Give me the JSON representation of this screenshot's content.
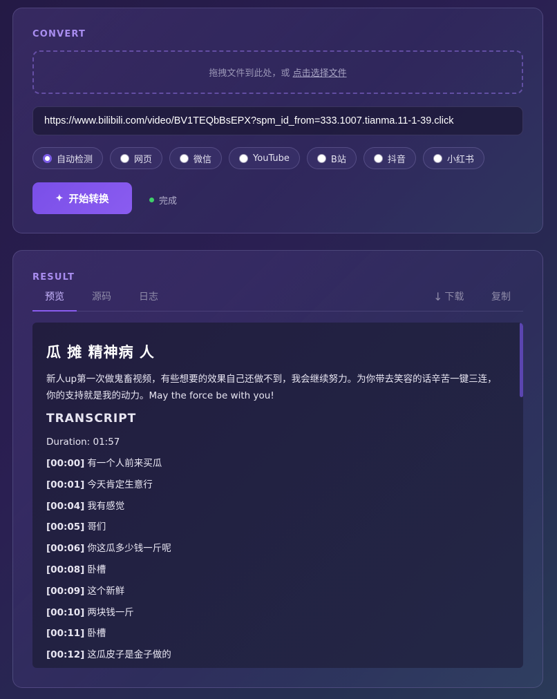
{
  "convert": {
    "section_label": "CONVERT",
    "dropzone_text": "拖拽文件到此处，或",
    "dropzone_link": "点击选择文件",
    "url_value": "https://www.bilibili.com/video/BV1TEQbBsEPX?spm_id_from=333.1007.tianma.11-1-39.click",
    "sources": [
      {
        "label": "自动检测",
        "selected": true
      },
      {
        "label": "网页",
        "selected": false
      },
      {
        "label": "微信",
        "selected": false
      },
      {
        "label": "YouTube",
        "selected": false
      },
      {
        "label": "B站",
        "selected": false
      },
      {
        "label": "抖音",
        "selected": false
      },
      {
        "label": "小红书",
        "selected": false
      }
    ],
    "start_button": "开始转换",
    "start_icon": "✦",
    "status_text": "完成",
    "status_color": "#3fcf6a"
  },
  "result": {
    "section_label": "RESULT",
    "tabs": [
      {
        "label": "预览",
        "active": true
      },
      {
        "label": "源码",
        "active": false
      },
      {
        "label": "日志",
        "active": false
      }
    ],
    "download_label": "下载",
    "download_icon": "↓",
    "copy_label": "复制",
    "doc": {
      "title": "瓜 摊 精神病 人",
      "description": "新人up第一次做鬼畜视频，有些想要的效果自己还做不到，我会继续努力。为你带去笑容的话辛苦一键三连，你的支持就是我的动力。May the force be with you!",
      "heading": "TRANSCRIPT",
      "duration": "Duration: 01:57",
      "lines": [
        {
          "ts": "[00:00]",
          "text": "有一个人前来买瓜"
        },
        {
          "ts": "[00:01]",
          "text": "今天肯定生意行"
        },
        {
          "ts": "[00:04]",
          "text": "我有感觉"
        },
        {
          "ts": "[00:05]",
          "text": "哥们"
        },
        {
          "ts": "[00:06]",
          "text": "你这瓜多少钱一斤呢"
        },
        {
          "ts": "[00:08]",
          "text": "卧槽"
        },
        {
          "ts": "[00:09]",
          "text": "这个新鲜"
        },
        {
          "ts": "[00:10]",
          "text": "两块钱一斤"
        },
        {
          "ts": "[00:11]",
          "text": "卧槽"
        },
        {
          "ts": "[00:12]",
          "text": "这瓜皮子是金子做的"
        }
      ]
    }
  },
  "colors": {
    "accent": "#8a5cf0",
    "section_label": "#a98df0",
    "status_ok": "#3fcf6a"
  }
}
